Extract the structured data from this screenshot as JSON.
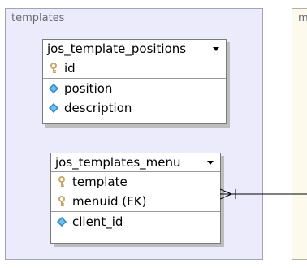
{
  "groups": {
    "templates": {
      "label": "templates"
    },
    "right": {
      "label": "m"
    }
  },
  "tables": {
    "positions": {
      "name": "jos_template_positions",
      "keys": [
        {
          "name": "id",
          "icon": "key-icon"
        }
      ],
      "columns": [
        {
          "name": "position",
          "icon": "column-icon"
        },
        {
          "name": "description",
          "icon": "column-icon"
        }
      ]
    },
    "menu": {
      "name": "jos_templates_menu",
      "keys": [
        {
          "name": "template",
          "icon": "key-icon"
        },
        {
          "name": "menuid (FK)",
          "icon": "key-icon"
        }
      ],
      "columns": [
        {
          "name": "client_id",
          "icon": "column-icon"
        }
      ]
    }
  },
  "colors": {
    "group_bg": "#ebebfb",
    "right_group_bg": "#fcfaed",
    "key_icon": "#c8a66b",
    "column_icon": "#2f86c4"
  }
}
